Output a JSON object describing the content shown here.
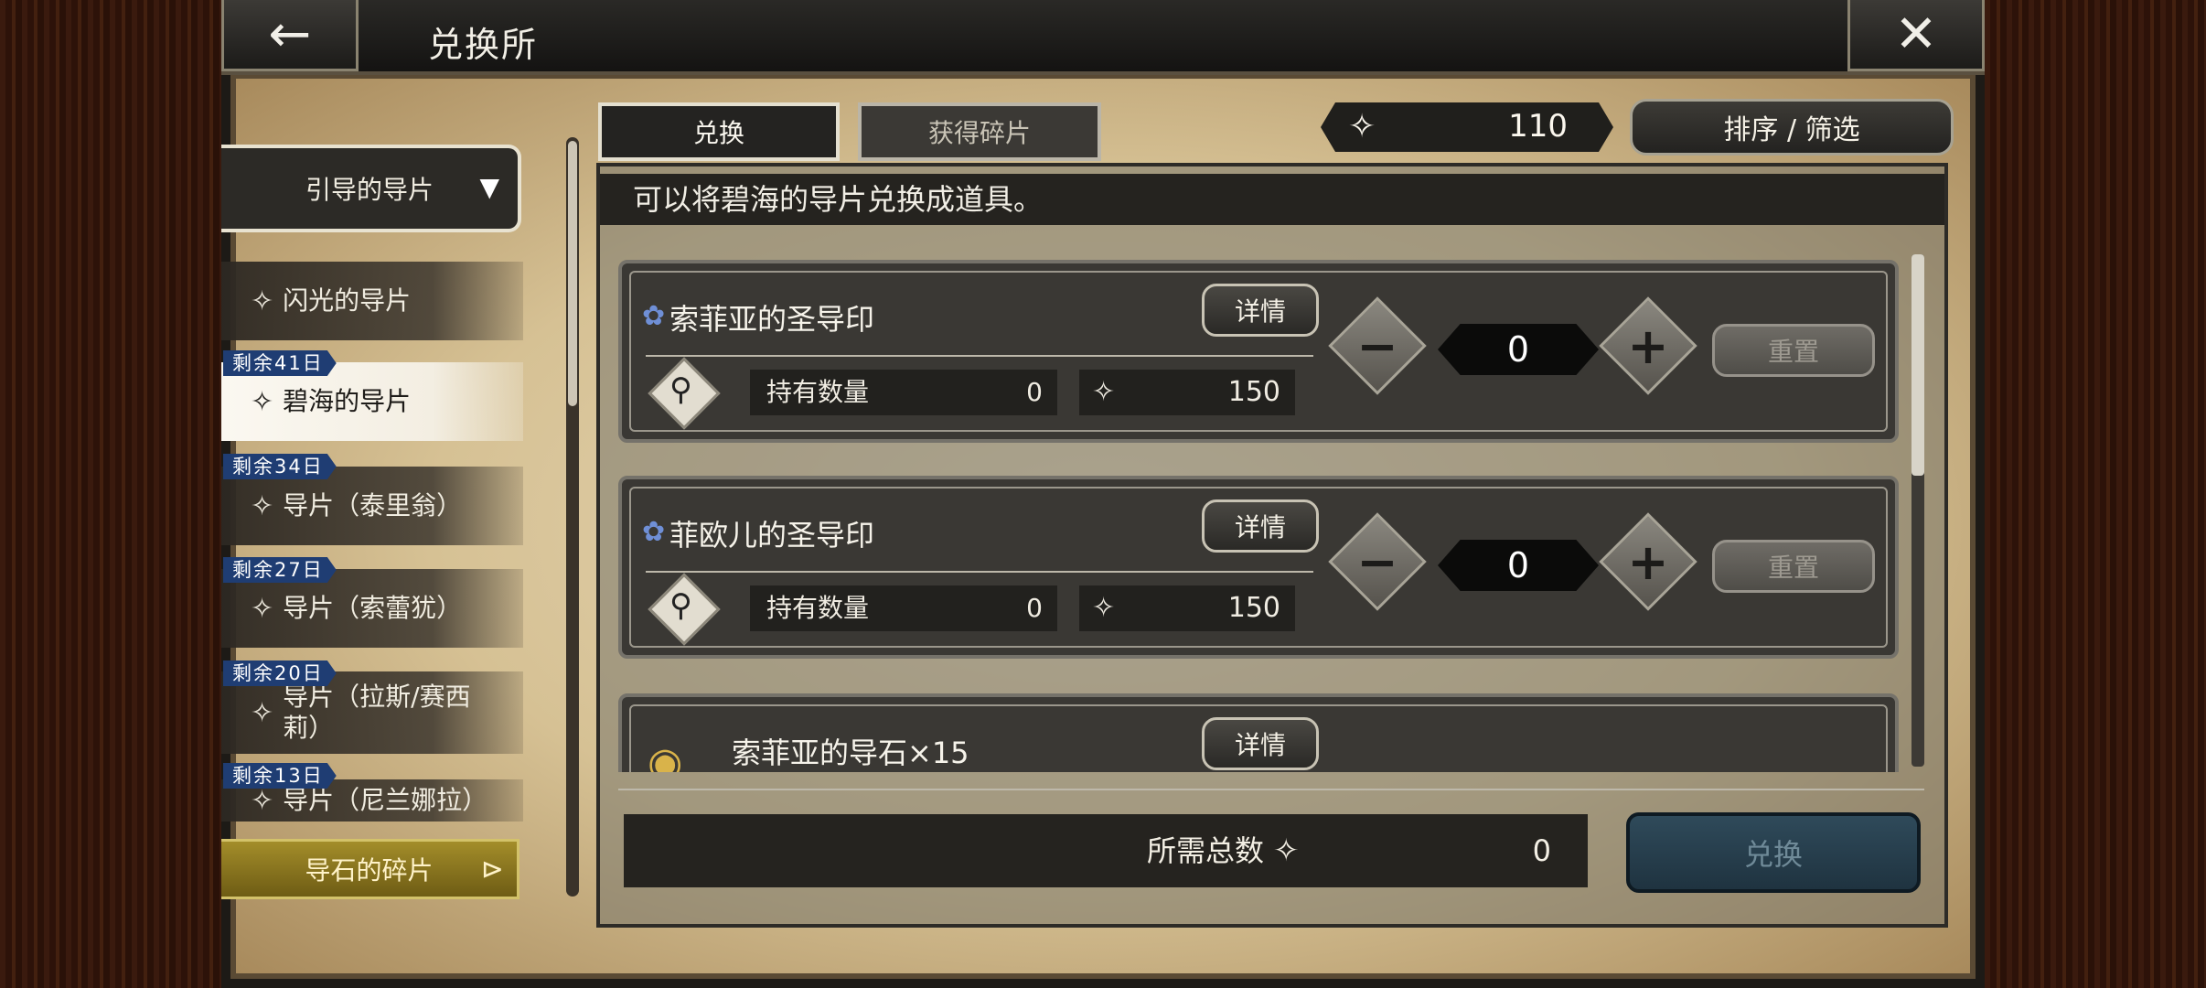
{
  "header": {
    "title": "兑换所",
    "back_icon": "left-arrow-icon",
    "close_icon": "close-icon"
  },
  "sidebar": {
    "category_selected": "引导的导片",
    "items": [
      {
        "label": "闪光的导片",
        "days": ""
      },
      {
        "label": "碧海的导片",
        "days": "剩余41日",
        "active": true
      },
      {
        "label": "导片（泰里翁）",
        "days": "剩余34日"
      },
      {
        "label": "导片（索蕾犹）",
        "days": "剩余27日"
      },
      {
        "label": "导片（拉斯/赛西莉）",
        "days": "剩余20日"
      },
      {
        "label": "导片（尼兰娜拉）",
        "days": "剩余13日"
      }
    ],
    "bottom_button": "导石的碎片"
  },
  "tabs": [
    {
      "label": "兑换",
      "active": true
    },
    {
      "label": "获得碎片",
      "active": false
    }
  ],
  "currency": {
    "value": "110"
  },
  "sort_button": "排序 / 筛选",
  "description": "可以将碧海的导片兑换成道具。",
  "items": [
    {
      "name": "索菲亚的圣导印",
      "detail": "详情",
      "hold_label": "持有数量",
      "hold": "0",
      "cost": "150",
      "qty": "0",
      "reset": "重置"
    },
    {
      "name": "菲欧儿的圣导印",
      "detail": "详情",
      "hold_label": "持有数量",
      "hold": "0",
      "cost": "150",
      "qty": "0",
      "reset": "重置"
    },
    {
      "name": "索菲亚的导石×15",
      "detail": "详情"
    }
  ],
  "footer": {
    "total_label": "所需总数",
    "total_value": "0",
    "exchange_button": "兑换"
  },
  "colors": {
    "accent_days": "#1f3d73",
    "panel_dark": "#25231f",
    "parchment": "#d6c194"
  }
}
